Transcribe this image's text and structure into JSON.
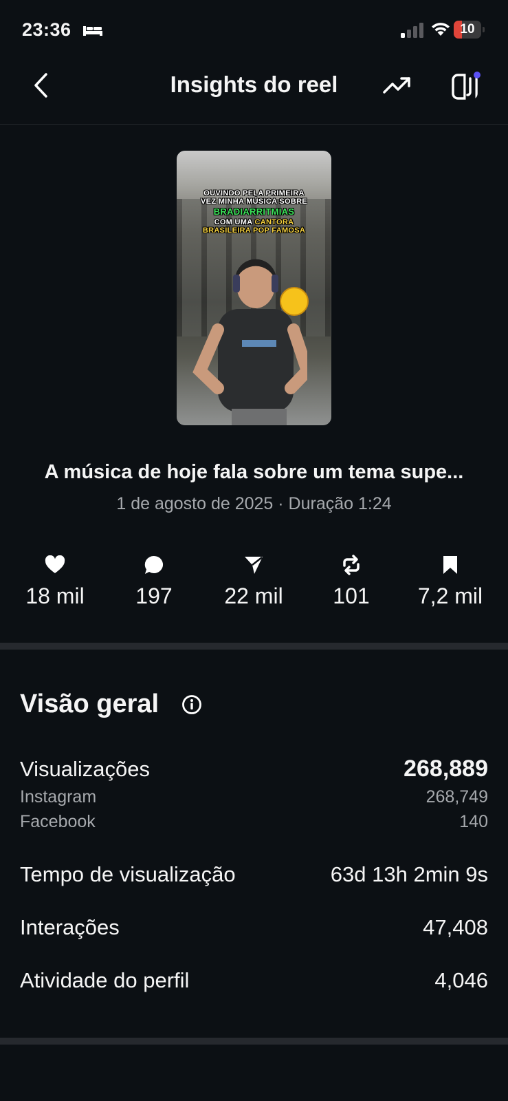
{
  "status_bar": {
    "time": "23:36",
    "battery": "10",
    "battery_level": 0.1
  },
  "header": {
    "title": "Insights do reel"
  },
  "thumbnail": {
    "caption_line1": "OUVINDO PELA PRIMEIRA",
    "caption_line2": "VEZ MINHA MÚSICA SOBRE",
    "caption_highlight": "BRADIARRITMIAS",
    "caption_line3_a": "COM UMA ",
    "caption_line3_b": "CANTORA",
    "caption_line4": "BRASILEIRA POP FAMOSA"
  },
  "reel": {
    "title": "A música de hoje fala sobre um tema supe...",
    "subtitle": "1 de agosto de 2025 · Duração 1:24"
  },
  "stats": [
    {
      "icon": "heart-icon",
      "value": "18 mil"
    },
    {
      "icon": "comment-icon",
      "value": "197"
    },
    {
      "icon": "share-icon",
      "value": "22 mil"
    },
    {
      "icon": "repost-icon",
      "value": "101"
    },
    {
      "icon": "bookmark-icon",
      "value": "7,2 mil"
    }
  ],
  "overview": {
    "title": "Visão geral",
    "views_label": "Visualizações",
    "views_value": "268,889",
    "instagram_label": "Instagram",
    "instagram_value": "268,749",
    "facebook_label": "Facebook",
    "facebook_value": "140",
    "watch_time_label": "Tempo de visualização",
    "watch_time_value": "63d 13h 2min 9s",
    "interactions_label": "Interações",
    "interactions_value": "47,408",
    "profile_label": "Atividade do perfil",
    "profile_value": "4,046"
  },
  "colors": {
    "background": "#0c1014",
    "secondary_text": "#a6a9ad",
    "accent_dot": "#5b51f5",
    "battery_red": "#e0453a"
  }
}
